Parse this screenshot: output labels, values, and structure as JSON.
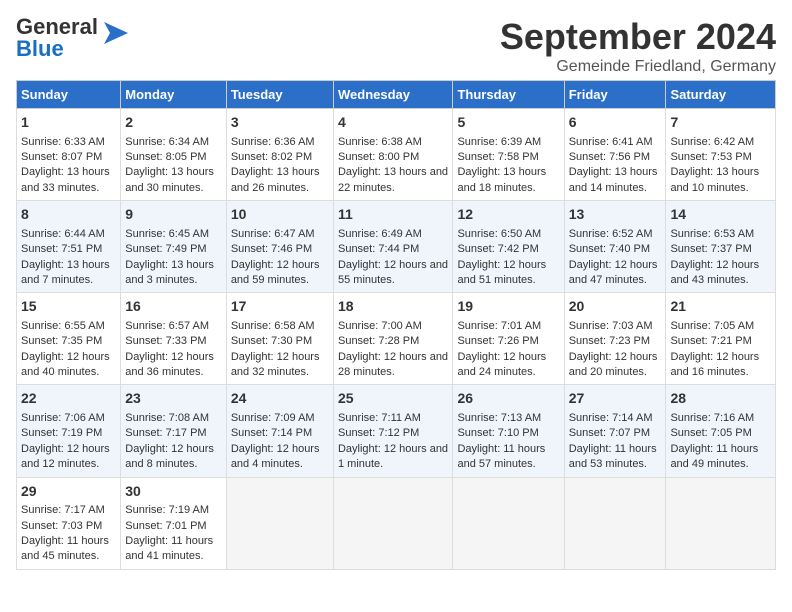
{
  "header": {
    "logo_general": "General",
    "logo_blue": "Blue",
    "title": "September 2024",
    "subtitle": "Gemeinde Friedland, Germany"
  },
  "days_of_week": [
    "Sunday",
    "Monday",
    "Tuesday",
    "Wednesday",
    "Thursday",
    "Friday",
    "Saturday"
  ],
  "weeks": [
    [
      {
        "day": "1",
        "sunrise": "6:33 AM",
        "sunset": "8:07 PM",
        "daylight": "13 hours and 33 minutes."
      },
      {
        "day": "2",
        "sunrise": "6:34 AM",
        "sunset": "8:05 PM",
        "daylight": "13 hours and 30 minutes."
      },
      {
        "day": "3",
        "sunrise": "6:36 AM",
        "sunset": "8:02 PM",
        "daylight": "13 hours and 26 minutes."
      },
      {
        "day": "4",
        "sunrise": "6:38 AM",
        "sunset": "8:00 PM",
        "daylight": "13 hours and 22 minutes."
      },
      {
        "day": "5",
        "sunrise": "6:39 AM",
        "sunset": "7:58 PM",
        "daylight": "13 hours and 18 minutes."
      },
      {
        "day": "6",
        "sunrise": "6:41 AM",
        "sunset": "7:56 PM",
        "daylight": "13 hours and 14 minutes."
      },
      {
        "day": "7",
        "sunrise": "6:42 AM",
        "sunset": "7:53 PM",
        "daylight": "13 hours and 10 minutes."
      }
    ],
    [
      {
        "day": "8",
        "sunrise": "6:44 AM",
        "sunset": "7:51 PM",
        "daylight": "13 hours and 7 minutes."
      },
      {
        "day": "9",
        "sunrise": "6:45 AM",
        "sunset": "7:49 PM",
        "daylight": "13 hours and 3 minutes."
      },
      {
        "day": "10",
        "sunrise": "6:47 AM",
        "sunset": "7:46 PM",
        "daylight": "12 hours and 59 minutes."
      },
      {
        "day": "11",
        "sunrise": "6:49 AM",
        "sunset": "7:44 PM",
        "daylight": "12 hours and 55 minutes."
      },
      {
        "day": "12",
        "sunrise": "6:50 AM",
        "sunset": "7:42 PM",
        "daylight": "12 hours and 51 minutes."
      },
      {
        "day": "13",
        "sunrise": "6:52 AM",
        "sunset": "7:40 PM",
        "daylight": "12 hours and 47 minutes."
      },
      {
        "day": "14",
        "sunrise": "6:53 AM",
        "sunset": "7:37 PM",
        "daylight": "12 hours and 43 minutes."
      }
    ],
    [
      {
        "day": "15",
        "sunrise": "6:55 AM",
        "sunset": "7:35 PM",
        "daylight": "12 hours and 40 minutes."
      },
      {
        "day": "16",
        "sunrise": "6:57 AM",
        "sunset": "7:33 PM",
        "daylight": "12 hours and 36 minutes."
      },
      {
        "day": "17",
        "sunrise": "6:58 AM",
        "sunset": "7:30 PM",
        "daylight": "12 hours and 32 minutes."
      },
      {
        "day": "18",
        "sunrise": "7:00 AM",
        "sunset": "7:28 PM",
        "daylight": "12 hours and 28 minutes."
      },
      {
        "day": "19",
        "sunrise": "7:01 AM",
        "sunset": "7:26 PM",
        "daylight": "12 hours and 24 minutes."
      },
      {
        "day": "20",
        "sunrise": "7:03 AM",
        "sunset": "7:23 PM",
        "daylight": "12 hours and 20 minutes."
      },
      {
        "day": "21",
        "sunrise": "7:05 AM",
        "sunset": "7:21 PM",
        "daylight": "12 hours and 16 minutes."
      }
    ],
    [
      {
        "day": "22",
        "sunrise": "7:06 AM",
        "sunset": "7:19 PM",
        "daylight": "12 hours and 12 minutes."
      },
      {
        "day": "23",
        "sunrise": "7:08 AM",
        "sunset": "7:17 PM",
        "daylight": "12 hours and 8 minutes."
      },
      {
        "day": "24",
        "sunrise": "7:09 AM",
        "sunset": "7:14 PM",
        "daylight": "12 hours and 4 minutes."
      },
      {
        "day": "25",
        "sunrise": "7:11 AM",
        "sunset": "7:12 PM",
        "daylight": "12 hours and 1 minute."
      },
      {
        "day": "26",
        "sunrise": "7:13 AM",
        "sunset": "7:10 PM",
        "daylight": "11 hours and 57 minutes."
      },
      {
        "day": "27",
        "sunrise": "7:14 AM",
        "sunset": "7:07 PM",
        "daylight": "11 hours and 53 minutes."
      },
      {
        "day": "28",
        "sunrise": "7:16 AM",
        "sunset": "7:05 PM",
        "daylight": "11 hours and 49 minutes."
      }
    ],
    [
      {
        "day": "29",
        "sunrise": "7:17 AM",
        "sunset": "7:03 PM",
        "daylight": "11 hours and 45 minutes."
      },
      {
        "day": "30",
        "sunrise": "7:19 AM",
        "sunset": "7:01 PM",
        "daylight": "11 hours and 41 minutes."
      },
      null,
      null,
      null,
      null,
      null
    ]
  ]
}
